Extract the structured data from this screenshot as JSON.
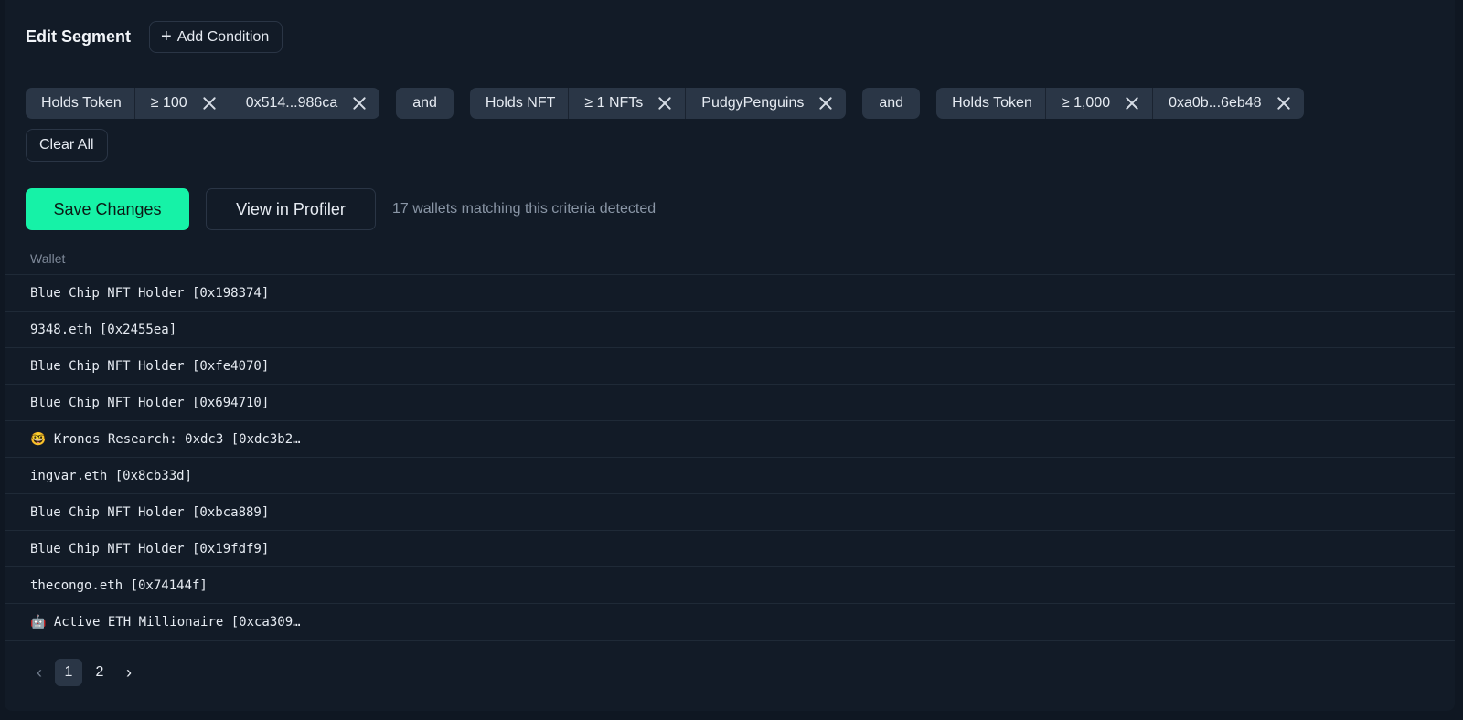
{
  "header": {
    "title": "Edit Segment",
    "add_condition_label": "Add Condition"
  },
  "conditions": [
    {
      "type": "Holds Token",
      "operator": "≥ 100",
      "value": "0x514...986ca"
    },
    {
      "joiner": "and"
    },
    {
      "type": "Holds NFT",
      "operator": "≥ 1 NFTs",
      "value": "PudgyPenguins"
    },
    {
      "joiner": "and"
    },
    {
      "type": "Holds Token",
      "operator": "≥ 1,000",
      "value": "0xa0b...6eb48"
    }
  ],
  "joiners": [
    "and",
    "and"
  ],
  "clear_all_label": "Clear All",
  "actions": {
    "save_label": "Save Changes",
    "profiler_label": "View in Profiler",
    "match_text": "17 wallets matching this criteria detected"
  },
  "table": {
    "column_header": "Wallet",
    "rows": [
      "Blue Chip NFT Holder [0x198374]",
      "9348.eth [0x2455ea]",
      "Blue Chip NFT Holder [0xfe4070]",
      "Blue Chip NFT Holder [0x694710]",
      "🤓 Kronos Research: 0xdc3 [0xdc3b2…",
      "ingvar.eth [0x8cb33d]",
      "Blue Chip NFT Holder [0xbca889]",
      "Blue Chip NFT Holder [0x19fdf9]",
      "thecongo.eth [0x74144f]",
      "🤖 Active ETH Millionaire [0xca309…"
    ]
  },
  "pagination": {
    "pages": [
      "1",
      "2"
    ],
    "current": "1"
  }
}
